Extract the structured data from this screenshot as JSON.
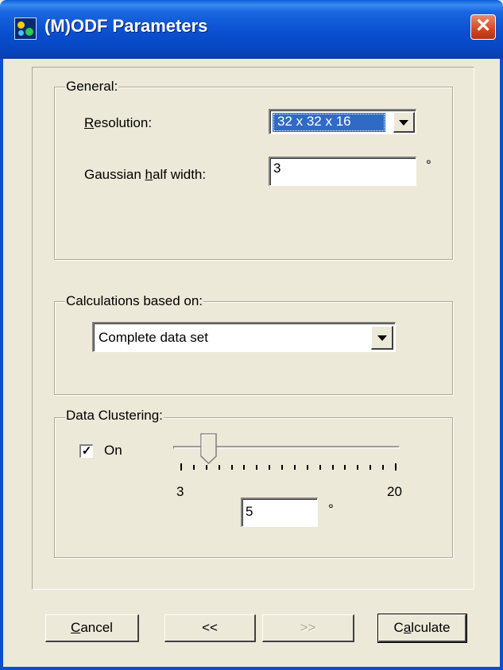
{
  "window": {
    "title": "(M)ODF Parameters",
    "close_glyph": "✕"
  },
  "general": {
    "legend": "General:",
    "resolution_label_key": "R",
    "resolution_label_rest": "esolution:",
    "resolution_value": "32 x 32 x 16",
    "gaussian_label_pre": "Gaussian ",
    "gaussian_label_key": "h",
    "gaussian_label_rest": "alf width:",
    "gaussian_value": "3",
    "gaussian_unit": "°"
  },
  "calc": {
    "legend": "Calculations based on:",
    "selected": "Complete data set"
  },
  "cluster": {
    "legend": "Data Clustering:",
    "checkbox_checked": true,
    "checkbox_mark": "✓",
    "checkbox_label": "On",
    "slider_min": "3",
    "slider_max": "20",
    "slider_value": 5,
    "value_text": "5",
    "unit": "°"
  },
  "buttons": {
    "cancel_key": "C",
    "cancel_rest": "ancel",
    "back": "<<",
    "next": ">>",
    "calculate_pre": "C",
    "calculate_key": "a",
    "calculate_rest": "lculate"
  }
}
